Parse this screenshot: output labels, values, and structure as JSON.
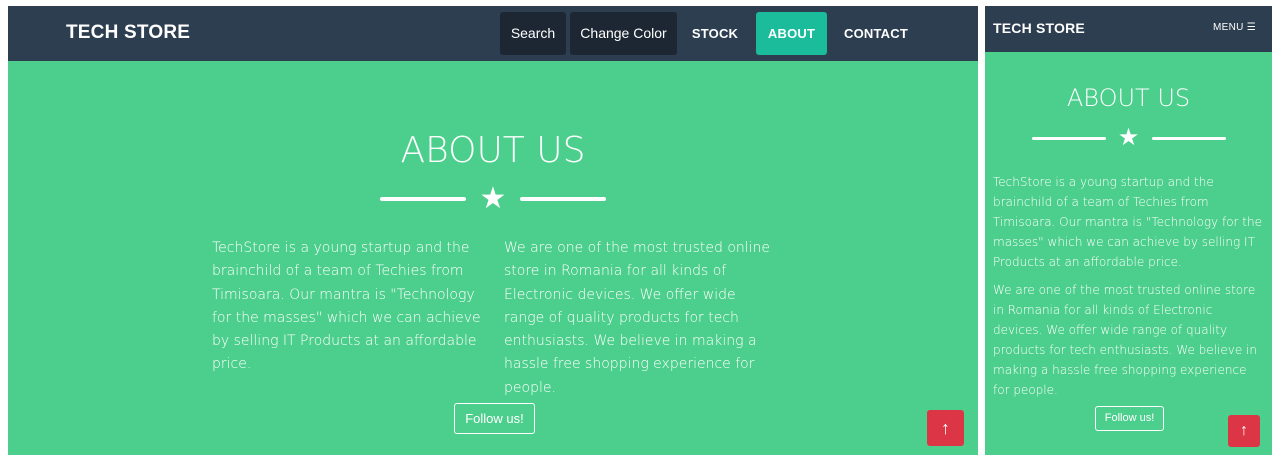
{
  "desktop": {
    "navbar": {
      "brand": "TECH STORE",
      "search_label": "Search",
      "change_color_label": "Change Color",
      "stock_label": "STOCK",
      "about_label": "ABOUT",
      "contact_label": "CONTACT"
    },
    "about": {
      "title": "ABOUT US",
      "star": "★",
      "paragraph1": "TechStore is a young startup and the brainchild of a team of Techies from Timisoara. Our mantra is \"Technology for the masses\" which we can achieve by selling IT Products at an affordable price.",
      "paragraph2": "We are one of the most trusted online store in Romania for all kinds of Electronic devices. We offer wide range of quality products for tech enthusiasts. We believe in making a hassle free shopping experience for people.",
      "follow_label": "Follow us!"
    },
    "scroll_top_icon": "↑"
  },
  "mobile": {
    "navbar": {
      "brand": "TECH STORE",
      "menu_label": "MENU ☰"
    },
    "about": {
      "title": "ABOUT US",
      "star": "★",
      "paragraph1": "TechStore is a young startup and the brainchild of a team of Techies from Timisoara. Our mantra is \"Technology for the masses\" which we can achieve by selling IT Products at an affordable price.",
      "paragraph2": "We are one of the most trusted online store in Romania for all kinds of Electronic devices. We offer wide range of quality products for tech enthusiasts. We believe in making a hassle free shopping experience for people.",
      "follow_label": "Follow us!"
    },
    "scroll_top_icon": "↑"
  },
  "colors": {
    "navbar": "#2c3e50",
    "section_bg": "#4ccf8c",
    "active_nav": "#1abc9c",
    "scroll_top": "#dc3545",
    "dark_button": "#1c2733"
  },
  "icons": {
    "star": "star-icon",
    "menu": "hamburger-menu-icon",
    "scroll_top": "arrow-up-icon"
  }
}
